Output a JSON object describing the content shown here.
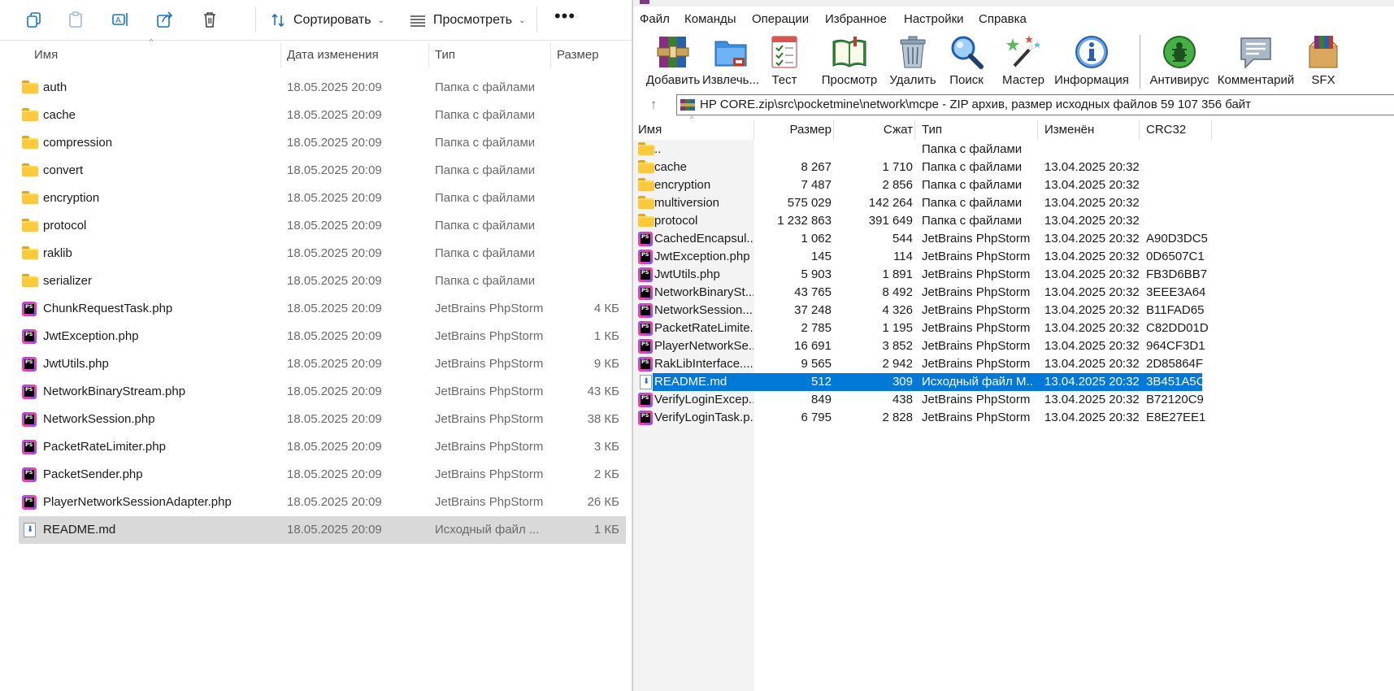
{
  "explorer": {
    "toolbar": {
      "sort_label": "Сортировать",
      "view_label": "Просмотреть",
      "more_label": "•••"
    },
    "columns": {
      "name": "Имя",
      "date": "Дата изменения",
      "type": "Тип",
      "size": "Размер"
    },
    "rows": [
      {
        "name": "auth",
        "date": "18.05.2025 20:09",
        "type": "Папка с файлами",
        "size": "",
        "icon": "folder-icon"
      },
      {
        "name": "cache",
        "date": "18.05.2025 20:09",
        "type": "Папка с файлами",
        "size": "",
        "icon": "folder-icon"
      },
      {
        "name": "compression",
        "date": "18.05.2025 20:09",
        "type": "Папка с файлами",
        "size": "",
        "icon": "folder-icon"
      },
      {
        "name": "convert",
        "date": "18.05.2025 20:09",
        "type": "Папка с файлами",
        "size": "",
        "icon": "folder-icon"
      },
      {
        "name": "encryption",
        "date": "18.05.2025 20:09",
        "type": "Папка с файлами",
        "size": "",
        "icon": "folder-icon"
      },
      {
        "name": "protocol",
        "date": "18.05.2025 20:09",
        "type": "Папка с файлами",
        "size": "",
        "icon": "folder-icon"
      },
      {
        "name": "raklib",
        "date": "18.05.2025 20:09",
        "type": "Папка с файлами",
        "size": "",
        "icon": "folder-icon"
      },
      {
        "name": "serializer",
        "date": "18.05.2025 20:09",
        "type": "Папка с файлами",
        "size": "",
        "icon": "folder-icon"
      },
      {
        "name": "ChunkRequestTask.php",
        "date": "18.05.2025 20:09",
        "type": "JetBrains PhpStorm",
        "size": "4 КБ",
        "icon": "phpstorm-icon"
      },
      {
        "name": "JwtException.php",
        "date": "18.05.2025 20:09",
        "type": "JetBrains PhpStorm",
        "size": "1 КБ",
        "icon": "phpstorm-icon"
      },
      {
        "name": "JwtUtils.php",
        "date": "18.05.2025 20:09",
        "type": "JetBrains PhpStorm",
        "size": "9 КБ",
        "icon": "phpstorm-icon"
      },
      {
        "name": "NetworkBinaryStream.php",
        "date": "18.05.2025 20:09",
        "type": "JetBrains PhpStorm",
        "size": "43 КБ",
        "icon": "phpstorm-icon"
      },
      {
        "name": "NetworkSession.php",
        "date": "18.05.2025 20:09",
        "type": "JetBrains PhpStorm",
        "size": "38 КБ",
        "icon": "phpstorm-icon"
      },
      {
        "name": "PacketRateLimiter.php",
        "date": "18.05.2025 20:09",
        "type": "JetBrains PhpStorm",
        "size": "3 КБ",
        "icon": "phpstorm-icon"
      },
      {
        "name": "PacketSender.php",
        "date": "18.05.2025 20:09",
        "type": "JetBrains PhpStorm",
        "size": "2 КБ",
        "icon": "phpstorm-icon"
      },
      {
        "name": "PlayerNetworkSessionAdapter.php",
        "date": "18.05.2025 20:09",
        "type": "JetBrains PhpStorm",
        "size": "26 КБ",
        "icon": "phpstorm-icon"
      },
      {
        "name": "README.md",
        "date": "18.05.2025 20:09",
        "type": "Исходный файл ...",
        "size": "1 КБ",
        "icon": "markdown-file-icon",
        "selected": true
      }
    ]
  },
  "winrar": {
    "menu": [
      "Файл",
      "Команды",
      "Операции",
      "Избранное",
      "Настройки",
      "Справка"
    ],
    "tools": [
      {
        "label": "Добавить",
        "icon": "add-archive-icon"
      },
      {
        "label": "Извлечь...",
        "icon": "extract-icon"
      },
      {
        "label": "Тест",
        "icon": "test-icon"
      },
      {
        "label": "Просмотр",
        "icon": "view-book-icon"
      },
      {
        "label": "Удалить",
        "icon": "trash-icon"
      },
      {
        "label": "Поиск",
        "icon": "magnifier-icon"
      },
      {
        "label": "Мастер",
        "icon": "wizard-icon"
      },
      {
        "label": "Информация",
        "icon": "info-icon"
      },
      {
        "label": "Антивирус",
        "icon": "antivirus-bug-icon"
      },
      {
        "label": "Комментарий",
        "icon": "comment-icon"
      },
      {
        "label": "SFX",
        "icon": "sfx-icon"
      }
    ],
    "path": "HP CORE.zip\\src\\pocketmine\\network\\mcpe - ZIP архив, размер исходных файлов 59 107 356 байт",
    "columns": {
      "name": "Имя",
      "size": "Размер",
      "packed": "Сжат",
      "type": "Тип",
      "modified": "Изменён",
      "crc": "CRC32"
    },
    "rows": [
      {
        "name": "..",
        "size": "",
        "packed": "",
        "type": "Папка с файлами",
        "modified": "",
        "crc": "",
        "icon": "folder-icon"
      },
      {
        "name": "cache",
        "size": "8 267",
        "packed": "1 710",
        "type": "Папка с файлами",
        "modified": "13.04.2025 20:32",
        "crc": "",
        "icon": "folder-icon"
      },
      {
        "name": "encryption",
        "size": "7 487",
        "packed": "2 856",
        "type": "Папка с файлами",
        "modified": "13.04.2025 20:32",
        "crc": "",
        "icon": "folder-icon"
      },
      {
        "name": "multiversion",
        "size": "575 029",
        "packed": "142 264",
        "type": "Папка с файлами",
        "modified": "13.04.2025 20:32",
        "crc": "",
        "icon": "folder-icon"
      },
      {
        "name": "protocol",
        "size": "1 232 863",
        "packed": "391 649",
        "type": "Папка с файлами",
        "modified": "13.04.2025 20:32",
        "crc": "",
        "icon": "folder-icon"
      },
      {
        "name": "CachedEncapsul...",
        "size": "1 062",
        "packed": "544",
        "type": "JetBrains PhpStorm",
        "modified": "13.04.2025 20:32",
        "crc": "A90D3DC5",
        "icon": "phpstorm-icon"
      },
      {
        "name": "JwtException.php",
        "size": "145",
        "packed": "114",
        "type": "JetBrains PhpStorm",
        "modified": "13.04.2025 20:32",
        "crc": "0D6507C1",
        "icon": "phpstorm-icon"
      },
      {
        "name": "JwtUtils.php",
        "size": "5 903",
        "packed": "1 891",
        "type": "JetBrains PhpStorm",
        "modified": "13.04.2025 20:32",
        "crc": "FB3D6BB7",
        "icon": "phpstorm-icon"
      },
      {
        "name": "NetworkBinarySt...",
        "size": "43 765",
        "packed": "8 492",
        "type": "JetBrains PhpStorm",
        "modified": "13.04.2025 20:32",
        "crc": "3EEE3A64",
        "icon": "phpstorm-icon"
      },
      {
        "name": "NetworkSession....",
        "size": "37 248",
        "packed": "4 326",
        "type": "JetBrains PhpStorm",
        "modified": "13.04.2025 20:32",
        "crc": "B11FAD65",
        "icon": "phpstorm-icon"
      },
      {
        "name": "PacketRateLimite...",
        "size": "2 785",
        "packed": "1 195",
        "type": "JetBrains PhpStorm",
        "modified": "13.04.2025 20:32",
        "crc": "C82DD01D",
        "icon": "phpstorm-icon"
      },
      {
        "name": "PlayerNetworkSe...",
        "size": "16 691",
        "packed": "3 852",
        "type": "JetBrains PhpStorm",
        "modified": "13.04.2025 20:32",
        "crc": "964CF3D1",
        "icon": "phpstorm-icon"
      },
      {
        "name": "RakLibInterface....",
        "size": "9 565",
        "packed": "2 942",
        "type": "JetBrains PhpStorm",
        "modified": "13.04.2025 20:32",
        "crc": "2D85864F",
        "icon": "phpstorm-icon"
      },
      {
        "name": "README.md",
        "size": "512",
        "packed": "309",
        "type": "Исходный файл M...",
        "modified": "13.04.2025 20:32",
        "crc": "3B451A5C",
        "icon": "markdown-file-icon",
        "selected": true
      },
      {
        "name": "VerifyLoginExcep...",
        "size": "849",
        "packed": "438",
        "type": "JetBrains PhpStorm",
        "modified": "13.04.2025 20:32",
        "crc": "B72120C9",
        "icon": "phpstorm-icon"
      },
      {
        "name": "VerifyLoginTask.p...",
        "size": "6 795",
        "packed": "2 828",
        "type": "JetBrains PhpStorm",
        "modified": "13.04.2025 20:32",
        "crc": "E8E27EE1",
        "icon": "phpstorm-icon"
      }
    ]
  },
  "colors": {
    "accent": "#0078d7",
    "explorer_selected": "#d9d9d9",
    "folder": "#ffc93c"
  }
}
